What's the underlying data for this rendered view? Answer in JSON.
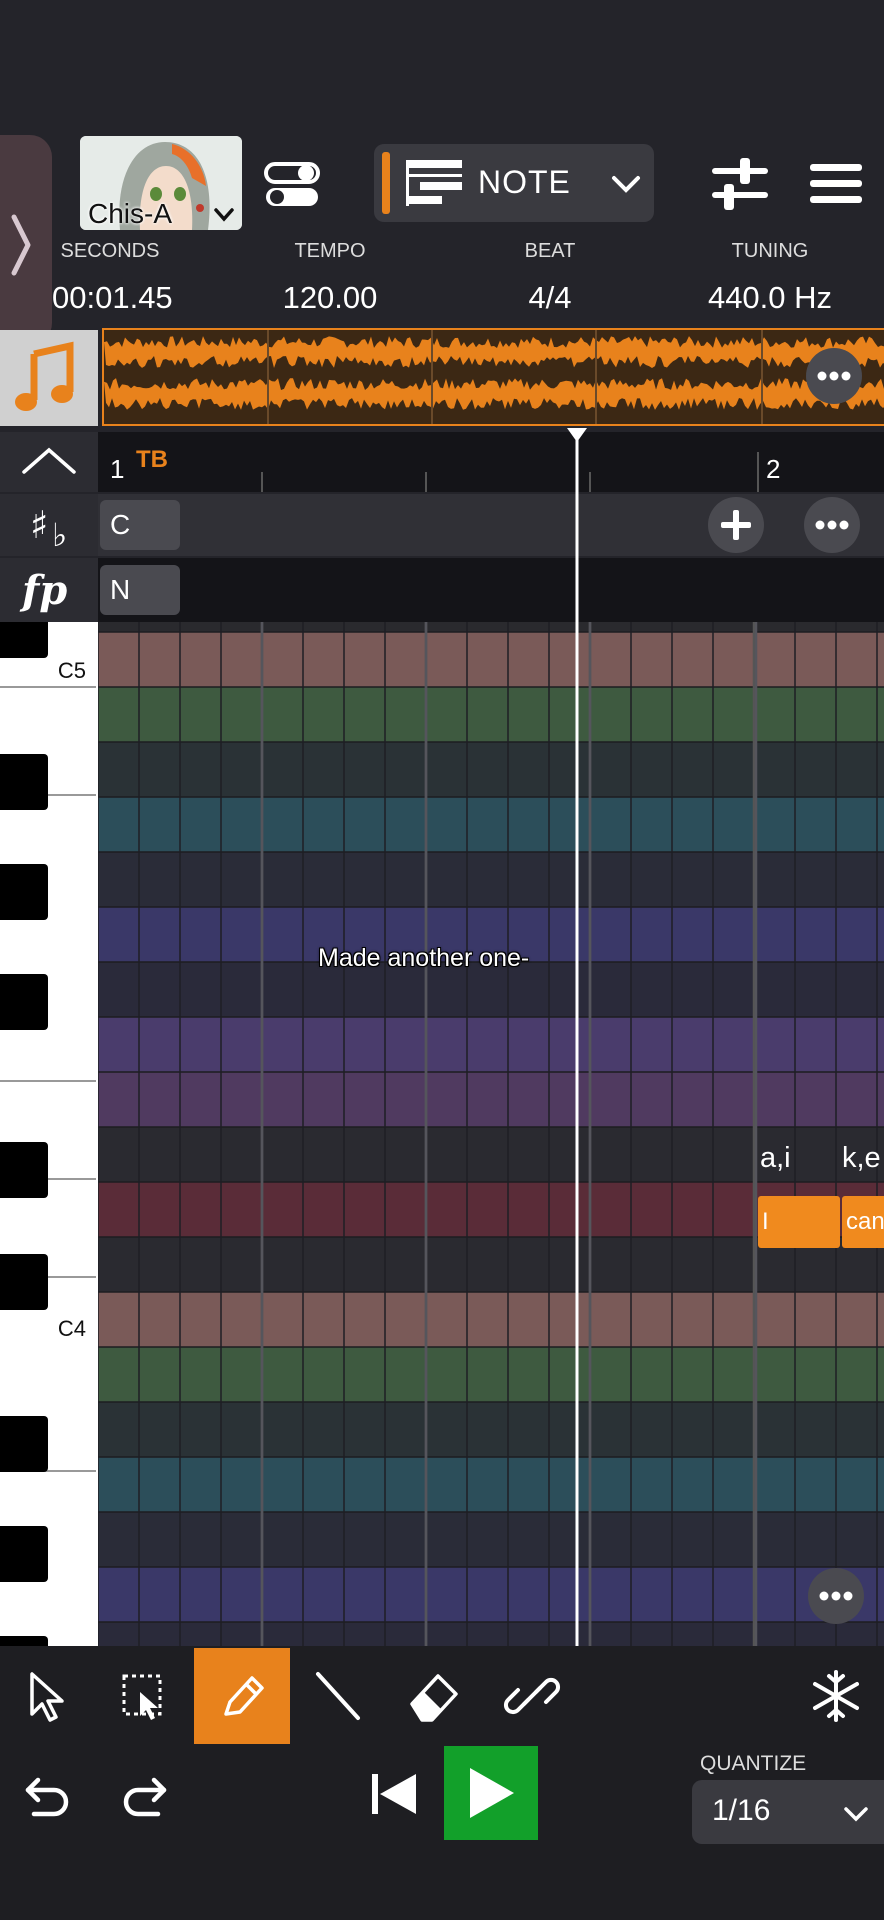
{
  "track": {
    "singer_name": "Chis-A"
  },
  "mode_select": {
    "label": "NOTE"
  },
  "info": {
    "seconds_label": "SECONDS",
    "seconds_value": "00:01.45",
    "tempo_label": "TEMPO",
    "tempo_value": "120.00",
    "beat_label": "BEAT",
    "beat_value": "4/4",
    "tuning_label": "TUNING",
    "tuning_value": "440.0 Hz"
  },
  "ruler": {
    "bar1": "1",
    "bar1_marker": "TB",
    "bar2": "2"
  },
  "key_track": {
    "chip": "C"
  },
  "dynamics_track": {
    "chip": "N"
  },
  "piano": {
    "c5_label": "C5",
    "c4_label": "C4"
  },
  "subtitle": "Made another one-",
  "notes": [
    {
      "lyric": "I",
      "phoneme": "a,i"
    },
    {
      "lyric": "can",
      "phoneme": "k,e"
    }
  ],
  "quantize": {
    "label": "QUANTIZE",
    "value": "1/16"
  },
  "colors": {
    "accent": "#e8821c",
    "play": "#12a02a"
  }
}
